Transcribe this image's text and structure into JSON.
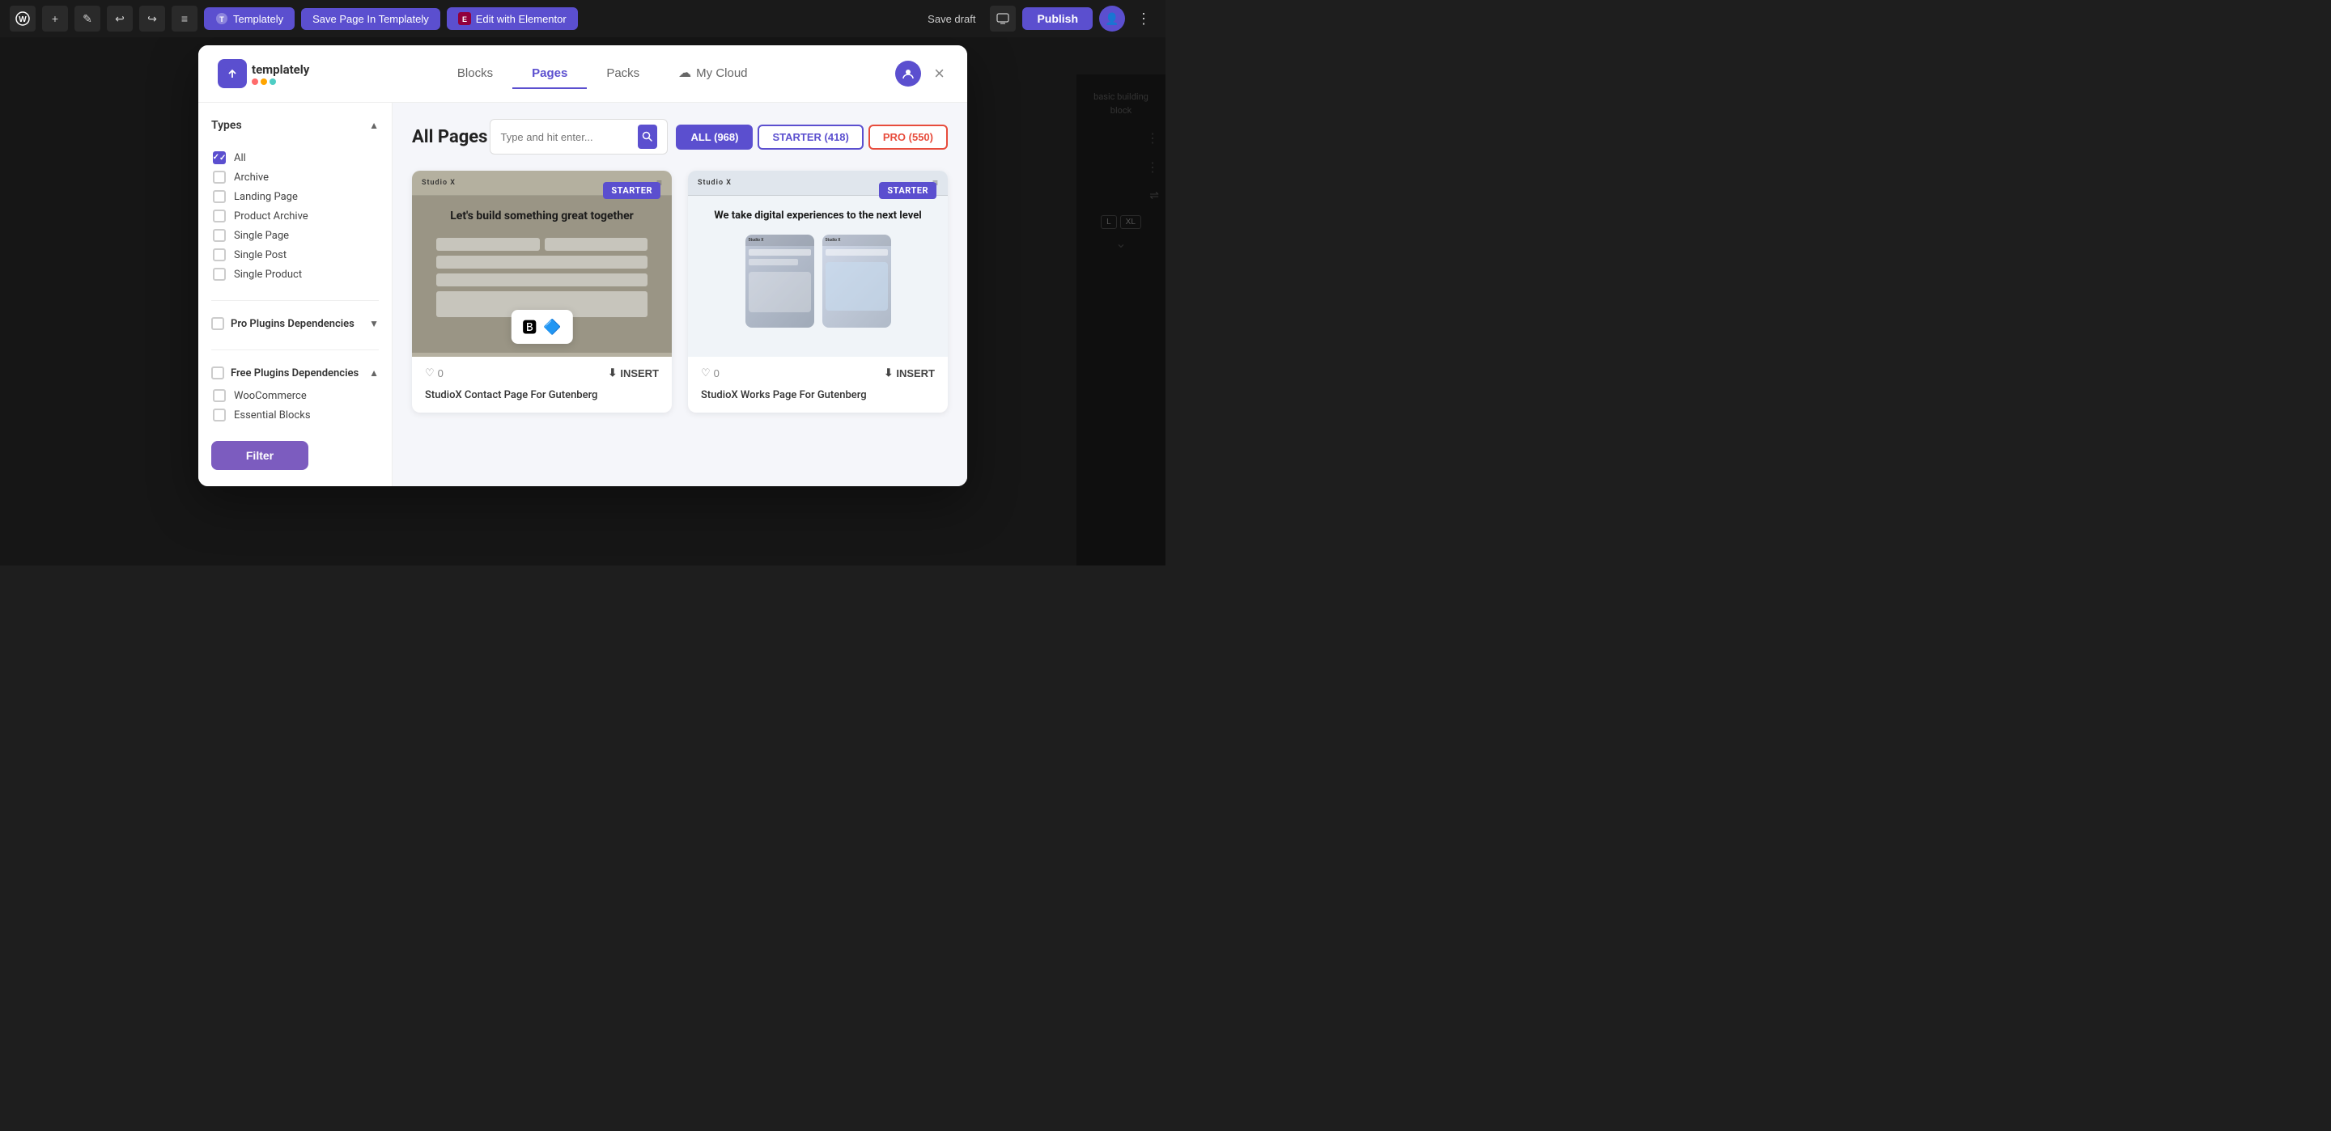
{
  "adminBar": {
    "wpLogo": "⊞",
    "addIcon": "+",
    "editIcon": "✎",
    "undoIcon": "↩",
    "redoIcon": "↪",
    "listIcon": "≡",
    "templaTelyLabel": "Templately",
    "savePageLabel": "Save Page In Templately",
    "editWithLabel": "Edit with Elementor",
    "saveDraftLabel": "Save draft",
    "publishLabel": "Publish",
    "moreIcon": "⋮"
  },
  "modal": {
    "logoText": "templately",
    "logoIcon": "T",
    "dots": [
      {
        "color": "#ff6b6b"
      },
      {
        "color": "#ffa500"
      },
      {
        "color": "#4ecdc4"
      }
    ],
    "tabs": [
      {
        "id": "blocks",
        "label": "Blocks",
        "active": false
      },
      {
        "id": "pages",
        "label": "Pages",
        "active": true
      },
      {
        "id": "packs",
        "label": "Packs",
        "active": false
      },
      {
        "id": "mycloud",
        "label": "My Cloud",
        "active": false,
        "hasIcon": true
      }
    ],
    "closeLabel": "×",
    "profileIcon": "👤"
  },
  "sidebar": {
    "typesLabel": "Types",
    "collapseIcon": "▲",
    "types": [
      {
        "id": "all",
        "label": "All",
        "checked": true
      },
      {
        "id": "archive",
        "label": "Archive",
        "checked": false
      },
      {
        "id": "landing",
        "label": "Landing Page",
        "checked": false
      },
      {
        "id": "product-archive",
        "label": "Product Archive",
        "checked": false
      },
      {
        "id": "single-page",
        "label": "Single Page",
        "checked": false
      },
      {
        "id": "single-post",
        "label": "Single Post",
        "checked": false
      },
      {
        "id": "single-product",
        "label": "Single Product",
        "checked": false
      }
    ],
    "proPluginsLabel": "Pro Plugins Dependencies",
    "proCollapseIcon": "▼",
    "freePluginsLabel": "Free Plugins Dependencies",
    "freeCollapseIcon": "▲",
    "freePlugins": [
      {
        "id": "woocommerce",
        "label": "WooCommerce",
        "checked": false
      },
      {
        "id": "essential-blocks",
        "label": "Essential Blocks",
        "checked": false
      }
    ],
    "filterButtonLabel": "Filter"
  },
  "content": {
    "title": "All Pages",
    "searchPlaceholder": "Type and hit enter...",
    "searchIcon": "🔍",
    "filterTabs": [
      {
        "id": "all",
        "label": "ALL (968)",
        "active": true
      },
      {
        "id": "starter",
        "label": "STARTER (418)",
        "active": false
      },
      {
        "id": "pro",
        "label": "PRO (550)",
        "active": false
      }
    ],
    "cards": [
      {
        "id": "card1",
        "badge": "STARTER",
        "title": "StudioX Contact Page For Gutenberg",
        "studioLogoText": "Studio X",
        "menuDots": "≡",
        "mainHeading": "Let's build something great together",
        "heartIcon": "♡",
        "heartCount": "0",
        "insertIcon": "⬇",
        "insertLabel": "INSERT"
      },
      {
        "id": "card2",
        "badge": "STARTER",
        "title": "StudioX Works Page For Gutenberg",
        "studioLogoText": "Studio X",
        "menuDots": "≡",
        "mainHeading": "We take digital experiences to the next level",
        "heartIcon": "♡",
        "heartCount": "0",
        "insertIcon": "⬇",
        "insertLabel": "INSERT"
      }
    ]
  },
  "rightPanel": {
    "basicBuildingText": "basic building block",
    "dotsMenu": "⋮",
    "sizeLabels": [
      "L",
      "XL"
    ],
    "chevronDown": "⌄",
    "slidersIcon": "⇌"
  }
}
